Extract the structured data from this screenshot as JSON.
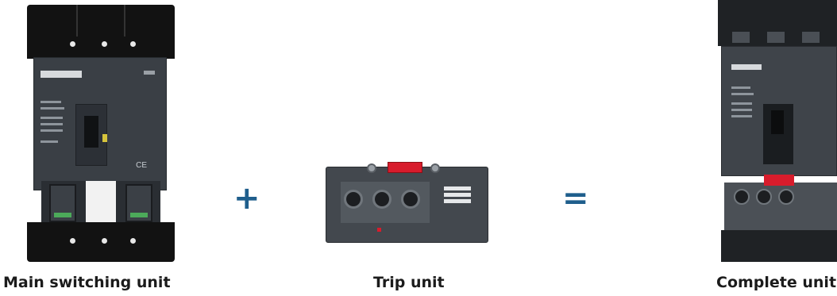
{
  "operators": {
    "plus": "+",
    "equals": "="
  },
  "products": [
    {
      "caption": "Main switching unit"
    },
    {
      "caption": "Trip unit"
    },
    {
      "caption": "Complete unit"
    }
  ],
  "colors": {
    "operator": "#1f5e8c",
    "caption": "#1b1b1b",
    "trip_indicator": "#d81c2c"
  }
}
